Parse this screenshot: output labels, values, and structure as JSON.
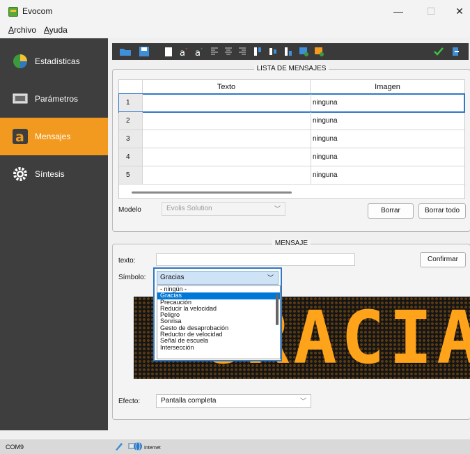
{
  "window": {
    "title": "Evocom",
    "minimize": "—",
    "maximize": "☐",
    "close": "✕"
  },
  "menu": [
    {
      "label": "Archivo"
    },
    {
      "label": "Ayuda"
    }
  ],
  "sidebar": {
    "items": [
      {
        "label": "Estadísticas",
        "icon": "pie-chart-icon",
        "active": false
      },
      {
        "label": "Parámetros",
        "icon": "chip-icon",
        "active": false
      },
      {
        "label": "Mensajes",
        "icon": "letter-a-icon",
        "active": true
      },
      {
        "label": "Síntesis",
        "icon": "gear-icon",
        "active": false
      }
    ]
  },
  "toolbar": {
    "buttons": [
      "open-folder-icon",
      "save-icon",
      "blank-icon",
      "text-small-icon",
      "text-large-icon",
      "align-left-icon",
      "align-center-icon",
      "align-right-icon",
      "align-top-icon",
      "align-middle-icon",
      "align-bottom-icon",
      "image-add-icon",
      "image-edit-icon",
      "confirm-icon",
      "exit-icon"
    ],
    "accent": "#2f78c4"
  },
  "lista": {
    "legend": "LISTA DE MENSAJES",
    "columns": [
      "Texto",
      "Imagen"
    ],
    "rows": [
      {
        "num": "1",
        "texto": "",
        "imagen": "ninguna"
      },
      {
        "num": "2",
        "texto": "",
        "imagen": "ninguna"
      },
      {
        "num": "3",
        "texto": "",
        "imagen": "ninguna"
      },
      {
        "num": "4",
        "texto": "",
        "imagen": "ninguna"
      },
      {
        "num": "5",
        "texto": "",
        "imagen": "ninguna"
      }
    ],
    "modelo_label": "Modelo",
    "modelo_value": "Evolis Solution",
    "borrar": "Borrar",
    "borrar_todo": "Borrar todo"
  },
  "mensaje": {
    "legend": "MENSAJE",
    "texto_label": "texto:",
    "texto_value": "",
    "confirmar": "Confirmar",
    "simbolo_label": "Símbolo:",
    "simbolo_value": "Gracias",
    "simbolo_options": [
      "- ningún -",
      "Gracias",
      "Precaución",
      "Reducir la velocidad",
      "Peligro",
      "Sonrisa",
      "Gesto de desaprobación",
      "Reductor de velocidad",
      "Señal de escuela",
      "Intersección"
    ],
    "led_text": "GRACIAS",
    "led_color": "#ffa41a",
    "efecto_label": "Efecto:",
    "efecto_value": "Pantalla completa"
  },
  "status": {
    "port": "COM9",
    "internet": "Internet"
  }
}
